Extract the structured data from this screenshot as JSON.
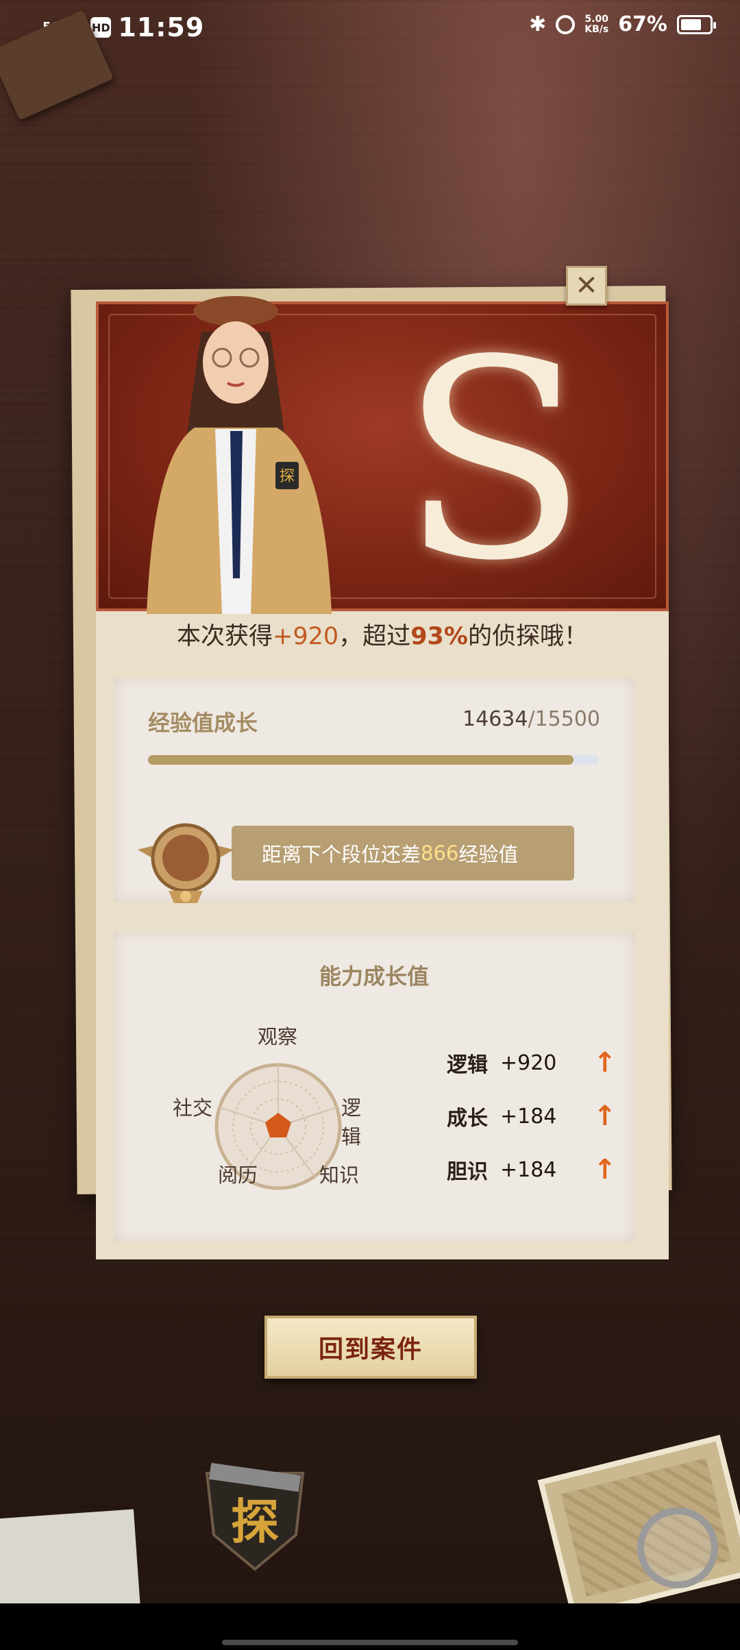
{
  "status_bar": {
    "network": "5G",
    "hd_badge": "HD",
    "time": "11:59",
    "speed_value": "5.00",
    "speed_unit": "KB/s",
    "battery_percent": "67%",
    "battery_level": 0.67
  },
  "result": {
    "grade": "S",
    "summary_prefix": "本次获得",
    "gain": "+920",
    "summary_mid": "，超过",
    "percent": "93%",
    "summary_suffix": "的侦探哦！"
  },
  "experience": {
    "title": "经验值成长",
    "current": "14634",
    "max": "/15500",
    "progress_fraction": 0.944,
    "rank_prefix": "距离下个段位还差",
    "rank_need": "866",
    "rank_suffix": "经验值"
  },
  "ability": {
    "title": "能力成长值",
    "radar_labels": {
      "top": "观察",
      "right": "逻辑",
      "bottom_right": "知识",
      "bottom_left": "阅历",
      "left": "社交"
    },
    "stats": [
      {
        "name": "逻辑",
        "value": "+920",
        "trend": "up-arrow-icon"
      },
      {
        "name": "成长",
        "value": "+184",
        "trend": "up-arrow-icon"
      },
      {
        "name": "胆识",
        "value": "+184",
        "trend": "up-arrow-icon"
      }
    ]
  },
  "actions": {
    "back_to_case": "回到案件",
    "close": "✕"
  },
  "decor": {
    "emblem_glyph": "探",
    "badge_glyph": "探",
    "accent_color": "#c05a22",
    "card_red": "#7a2414"
  }
}
